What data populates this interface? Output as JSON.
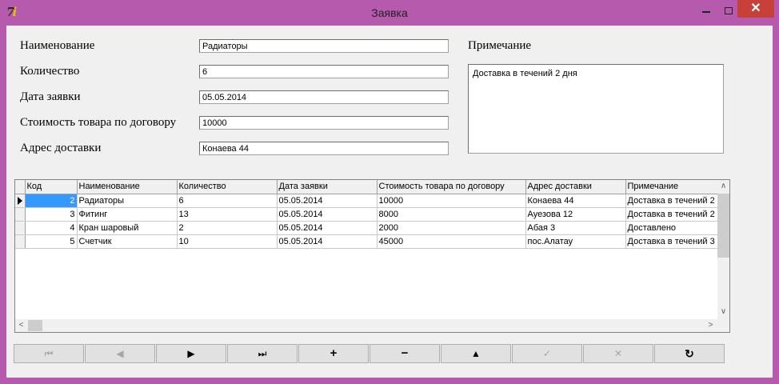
{
  "window": {
    "title": "Заявка",
    "close_glyph": "✕",
    "icon_text": "7",
    "icon_text2": "i"
  },
  "form": {
    "name_label": "Наименование",
    "name_value": "Радиаторы",
    "qty_label": "Количество",
    "qty_value": "6",
    "date_label": "Дата заявки",
    "date_value": "05.05.2014",
    "cost_label": "Стоимость товара по договору",
    "cost_value": "10000",
    "address_label": "Адрес доставки",
    "address_value": "Конаева 44",
    "note_label": "Примечание",
    "note_value": "Доставка в течений 2 дня"
  },
  "grid": {
    "columns": [
      "Код",
      "Наименование",
      "Количество",
      "Дата заявки",
      "Стоимость товара по договору",
      "Адрес доставки",
      "Примечание"
    ],
    "rows": [
      {
        "code": "2",
        "name": "Радиаторы",
        "qty": "6",
        "date": "05.05.2014",
        "cost": "10000",
        "address": "Конаева 44",
        "note": "Доставка в течений 2"
      },
      {
        "code": "3",
        "name": "Фитинг",
        "qty": "13",
        "date": "05.05.2014",
        "cost": "8000",
        "address": "Ауезова 12",
        "note": "Доставка в течений 2"
      },
      {
        "code": "4",
        "name": "Кран шаровый",
        "qty": "2",
        "date": "05.05.2014",
        "cost": "2000",
        "address": "Абая 3",
        "note": "Доставлено"
      },
      {
        "code": "5",
        "name": "Счетчик",
        "qty": "10",
        "date": "05.05.2014",
        "cost": "45000",
        "address": "пос.Алатау",
        "note": "Доставка в течений 3"
      }
    ],
    "selected_row": 0
  },
  "navigator": {
    "first": "⏮",
    "prior": "◀",
    "next": "▶",
    "last": "⏭",
    "insert": "+",
    "delete": "−",
    "edit": "▲",
    "post": "✓",
    "cancel": "✕",
    "refresh": "↻"
  }
}
